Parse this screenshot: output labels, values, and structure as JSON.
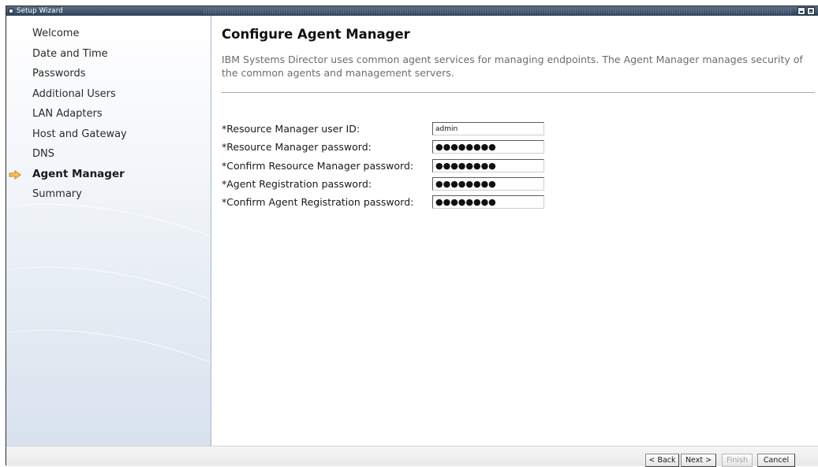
{
  "window": {
    "title": "Setup Wizard"
  },
  "sidebar": {
    "items": [
      {
        "label": "Welcome",
        "active": false
      },
      {
        "label": "Date and Time",
        "active": false
      },
      {
        "label": "Passwords",
        "active": false
      },
      {
        "label": "Additional Users",
        "active": false
      },
      {
        "label": "LAN Adapters",
        "active": false
      },
      {
        "label": "Host and Gateway",
        "active": false
      },
      {
        "label": "DNS",
        "active": false
      },
      {
        "label": "Agent Manager",
        "active": true
      },
      {
        "label": "Summary",
        "active": false
      }
    ],
    "active_indicator_icon": "arrow-right-icon",
    "active_indicator_color": "#f0a030"
  },
  "main": {
    "title": "Configure Agent Manager",
    "description": "IBM Systems Director uses common agent services for managing endpoints. The Agent Manager manages security of the common agents and management servers.",
    "fields": [
      {
        "label": "*Resource Manager user ID:",
        "value": "admin",
        "type": "text"
      },
      {
        "label": "*Resource Manager password:",
        "value": "●●●●●●●●",
        "type": "password"
      },
      {
        "label": "*Confirm Resource Manager password:",
        "value": "●●●●●●●●",
        "type": "password"
      },
      {
        "label": "*Agent Registration password:",
        "value": "●●●●●●●●",
        "type": "password"
      },
      {
        "label": "*Confirm Agent Registration password:",
        "value": "●●●●●●●●",
        "type": "password"
      }
    ]
  },
  "footer": {
    "back_label": "< Back",
    "next_label": "Next >",
    "finish_label": "Finish",
    "cancel_label": "Cancel"
  }
}
